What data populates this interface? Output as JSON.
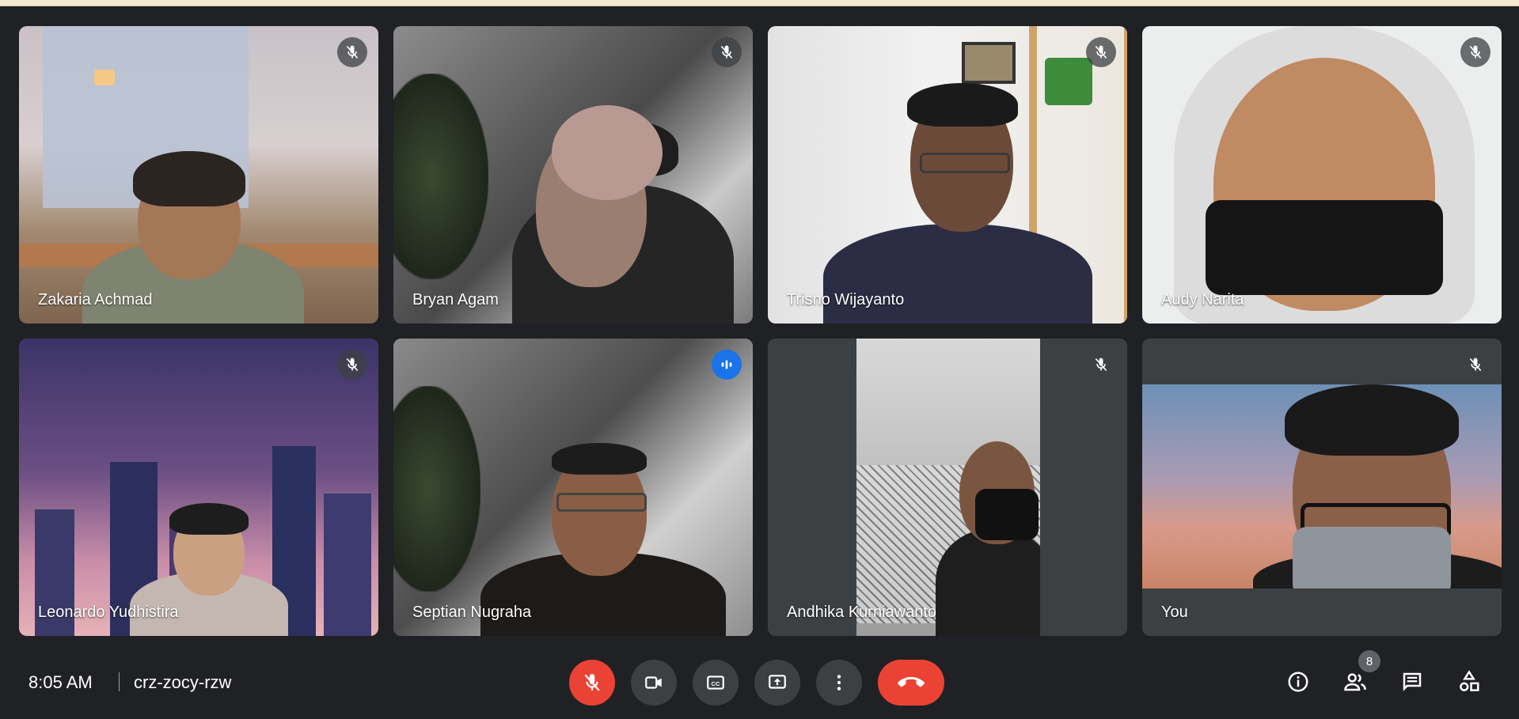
{
  "meeting": {
    "time": "8:05 AM",
    "code": "crz-zocy-rzw",
    "participant_count": "8"
  },
  "participants": [
    {
      "name": "Zakaria Achmad",
      "mic": "muted"
    },
    {
      "name": "Bryan Agam",
      "mic": "muted"
    },
    {
      "name": "Trisno Wijayanto",
      "mic": "muted"
    },
    {
      "name": "Audy Narita",
      "mic": "muted"
    },
    {
      "name": "Leonardo Yudhistira",
      "mic": "muted"
    },
    {
      "name": "Septian Nugraha",
      "mic": "speaking"
    },
    {
      "name": "Andhika Kurniawanto",
      "mic": "muted"
    },
    {
      "name": "You",
      "mic": "muted"
    }
  ],
  "controls": {
    "center": [
      "mic-off-icon",
      "camera-icon",
      "closed-captions-icon",
      "present-screen-icon",
      "more-options-icon",
      "hang-up-icon"
    ],
    "right": [
      "info-icon",
      "people-icon",
      "chat-icon",
      "activities-icon"
    ]
  },
  "colors": {
    "background": "#202124",
    "hangup": "#ea4335",
    "speaking": "#1a73e8",
    "active_outline": "#8ab4f8"
  }
}
